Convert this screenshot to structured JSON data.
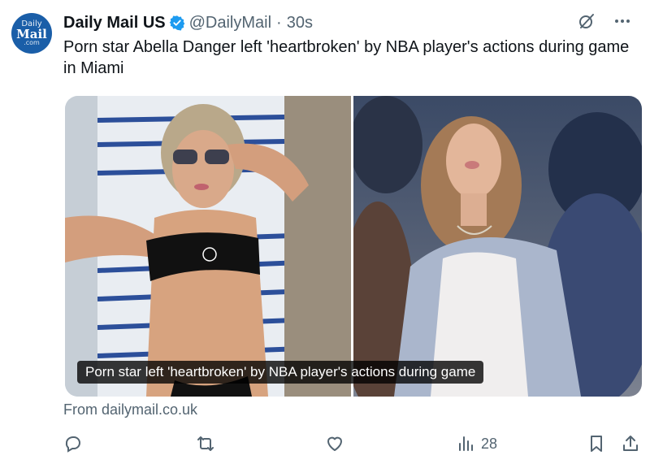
{
  "post": {
    "avatar": {
      "line1": "Daily",
      "line2": "Mail",
      "line3": ".com"
    },
    "author_name": "Daily Mail US",
    "handle": "@DailyMail",
    "separator": "·",
    "time": "30s",
    "text": "Porn star Abella Danger left 'heartbroken' by NBA player's actions during game in Miami",
    "media_caption": "Porn star left 'heartbroken' by NBA player's actions during game",
    "source": "From dailymail.co.uk",
    "views": "28"
  },
  "colors": {
    "avatar_bg": "#1a5ea8",
    "verified": "#1d9bf0",
    "text_primary": "#0f1419",
    "text_secondary": "#536471"
  },
  "icons": {
    "verified": "verified-badge-icon",
    "grok": "grok-icon",
    "more": "more-icon",
    "reply": "reply-icon",
    "repost": "repost-icon",
    "like": "like-icon",
    "views": "views-icon",
    "bookmark": "bookmark-icon",
    "share": "share-icon"
  }
}
